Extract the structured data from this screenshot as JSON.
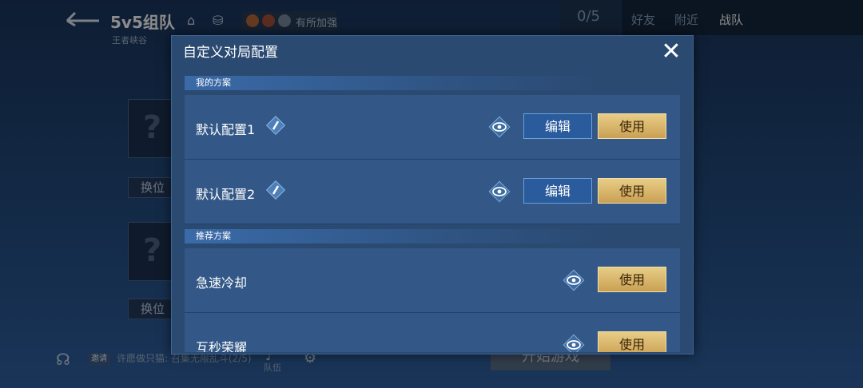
{
  "background": {
    "title": "5v5组队",
    "subtitle": "王者峡谷",
    "buff_text": "有所加强",
    "team_count": "0/5",
    "tabs": [
      "好友",
      "附近",
      "战队"
    ],
    "swap_label": "换位",
    "invite_tag": "邀请",
    "invite_text": "许愿做只猫: 召集无限乱斗(2/5)",
    "mic_label": "队伍",
    "start_label": "开始游戏"
  },
  "modal": {
    "title": "自定义对局配置",
    "my_section": "我的方案",
    "recommend_section": "推荐方案",
    "my_plans": [
      {
        "name": "默认配置1",
        "edit_label": "编辑",
        "use_label": "使用"
      },
      {
        "name": "默认配置2",
        "edit_label": "编辑",
        "use_label": "使用"
      }
    ],
    "recommended_plans": [
      {
        "name": "急速冷却",
        "use_label": "使用"
      },
      {
        "name": "互秒荣耀",
        "use_label": "使用"
      }
    ]
  },
  "icons": {
    "close": "close-icon",
    "edit": "pencil-icon",
    "preview": "eye-icon"
  },
  "colors": {
    "modal_bg": "#2a4a72",
    "row_bg": "#335887",
    "edit_button": "#2a5b9c",
    "use_button": "#d9b86a"
  }
}
